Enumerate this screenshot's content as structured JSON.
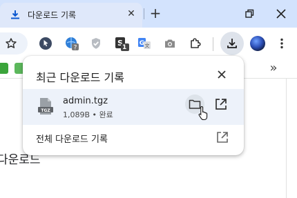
{
  "tab": {
    "title": "다운로드 기록",
    "close_glyph": "✕",
    "new_tab_glyph": "+"
  },
  "toolbar": {
    "extension_icons": [
      "pointer-extension-icon",
      "globe-extension-icon",
      "shield-extension-icon",
      "counter-extension-icon",
      "translate-extension-icon",
      "camera-extension-icon",
      "puzzle-extensions-icon"
    ],
    "extension_badge": "1",
    "download_icon": "download-icon"
  },
  "bookmarks": {
    "overflow_glyph": "»"
  },
  "page": {
    "heading_fragment": "다운로드"
  },
  "bubble": {
    "title": "최근 다운로드 기록",
    "item": {
      "file_name": "admin.tgz",
      "file_icon_label": "TGZ",
      "status": "1,089B • 완료"
    },
    "history_link": "전체 다운로드 기록"
  },
  "colors": {
    "tabstrip": "#d3e3fd",
    "row_highlight": "#edf2fa",
    "accent_blue": "#0b57d0"
  }
}
